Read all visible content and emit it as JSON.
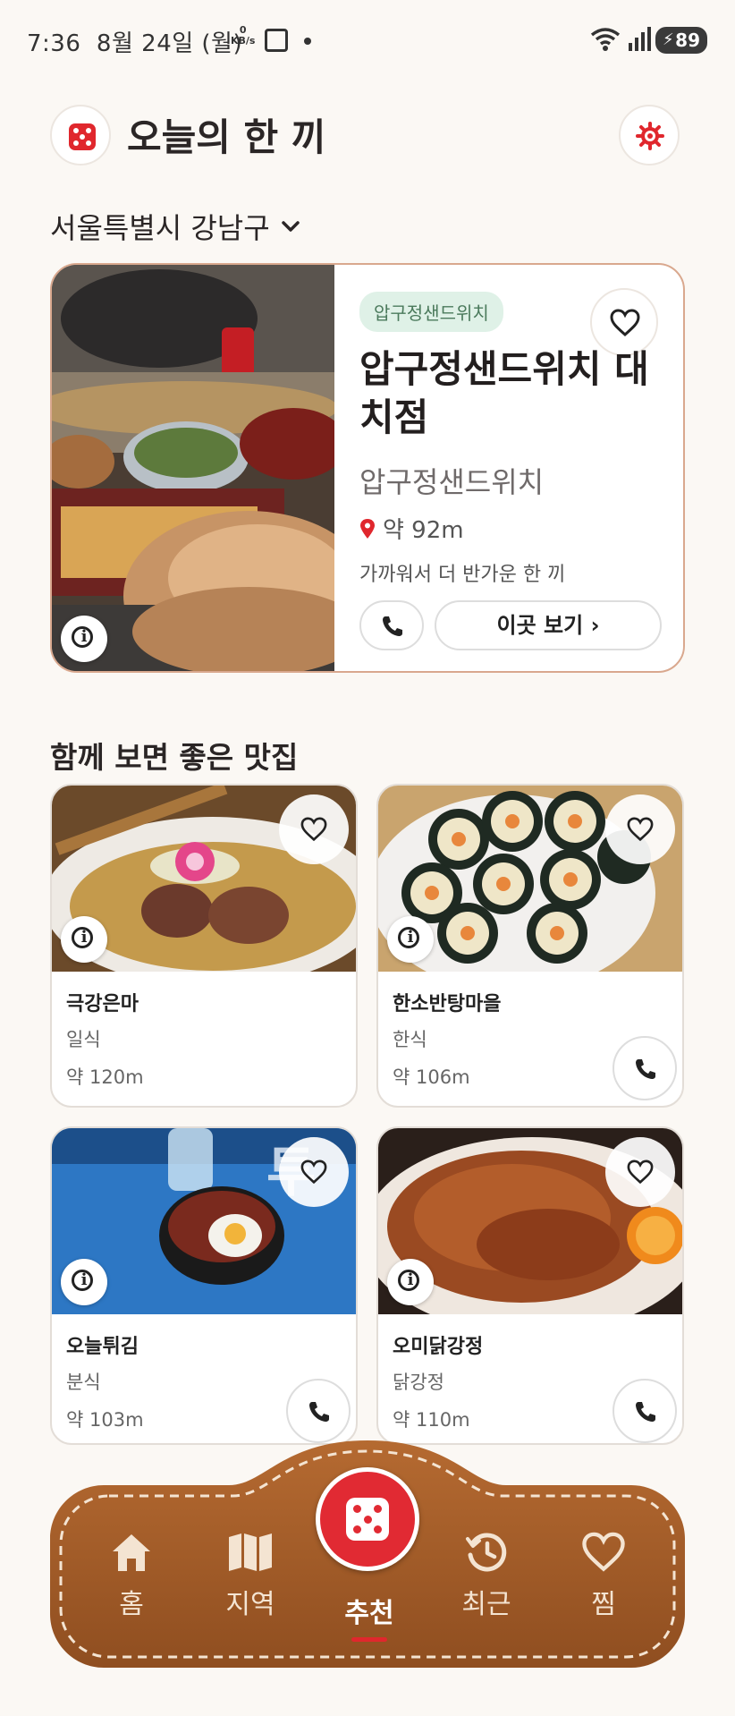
{
  "status_bar": {
    "time": "7:36",
    "date": "8월 24일 (월)",
    "net_speed_value": "0",
    "net_speed_unit": "KB/s",
    "battery": "89"
  },
  "header": {
    "title": "오늘의 한 끼"
  },
  "location": {
    "label": "서울특별시 강남구"
  },
  "featured": {
    "tag": "압구정샌드위치",
    "name": "압구정샌드위치 대치점",
    "brand": "압구정샌드위치",
    "distance": "약 92m",
    "note": "가까워서 더 반가운 한 끼",
    "view_label": "이곳 보기"
  },
  "section": {
    "title": "함께 보면 좋은 맛집"
  },
  "cards": [
    {
      "name": "극강은마",
      "category": "일식",
      "distance": "약 120m"
    },
    {
      "name": "한소반탕마을",
      "category": "한식",
      "distance": "약 106m"
    },
    {
      "name": "오늘튀김",
      "category": "분식",
      "distance": "약 103m"
    },
    {
      "name": "오미닭강정",
      "category": "닭강정",
      "distance": "약 110m"
    }
  ],
  "nav": {
    "home": "홈",
    "region": "지역",
    "recommend": "추천",
    "recent": "최근",
    "favorites": "찜"
  },
  "colors": {
    "accent": "#e0272d",
    "leather": "#a8602c",
    "tag_bg": "#dff1e7"
  }
}
